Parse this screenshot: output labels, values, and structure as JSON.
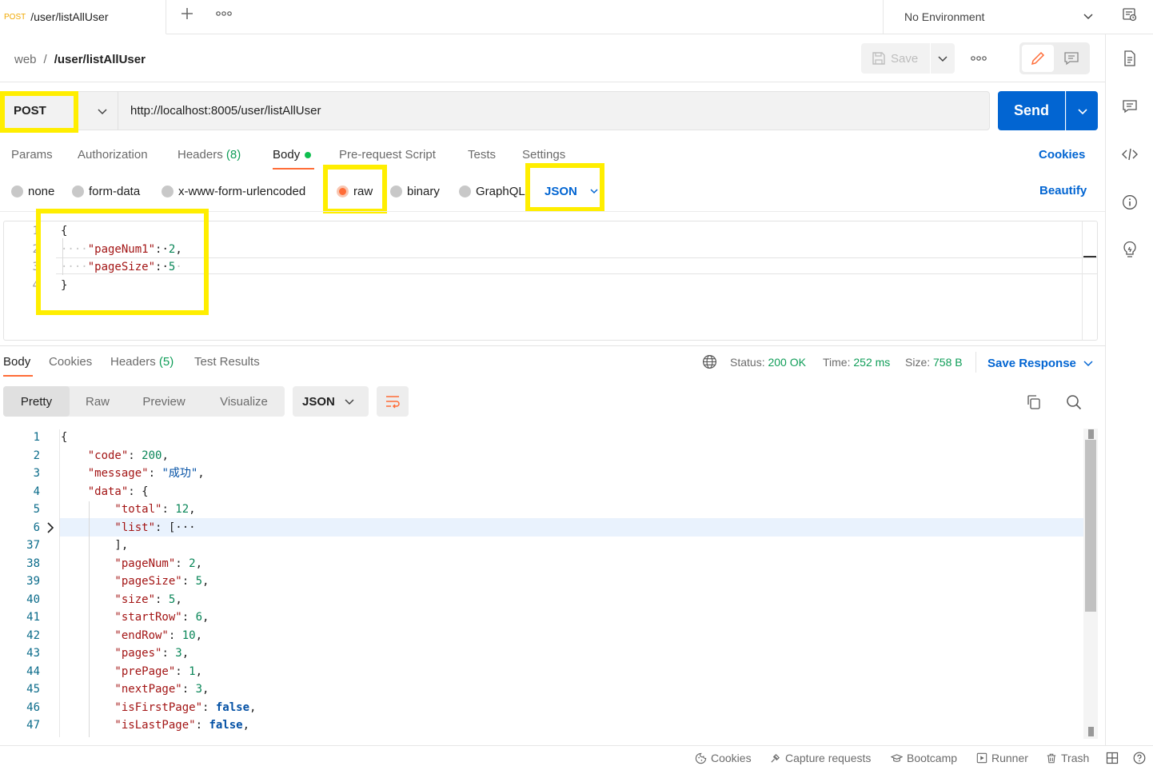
{
  "tab": {
    "method": "POST",
    "title": "/user/listAllUser"
  },
  "env": {
    "label": "No Environment"
  },
  "breadcrumb": {
    "collection": "web",
    "separator": "/",
    "request": "/user/listAllUser"
  },
  "toolbar": {
    "save_label": "Save"
  },
  "request": {
    "method": "POST",
    "url": "http://localhost:8005/user/listAllUser",
    "send_label": "Send"
  },
  "req_tabs": {
    "params": "Params",
    "authorization": "Authorization",
    "headers": "Headers",
    "headers_count": "(8)",
    "body": "Body",
    "prerequest": "Pre-request Script",
    "tests": "Tests",
    "settings": "Settings",
    "cookies": "Cookies"
  },
  "body_types": {
    "none": "none",
    "form_data": "form-data",
    "urlencoded": "x-www-form-urlencoded",
    "raw": "raw",
    "binary": "binary",
    "graphql": "GraphQL",
    "format": "JSON",
    "beautify": "Beautify"
  },
  "editor": {
    "line_numbers": [
      "1",
      "2",
      "3",
      "4"
    ],
    "lines": [
      [
        {
          "t": "{",
          "c": "p"
        }
      ],
      [
        {
          "t": "····",
          "c": "ws"
        },
        {
          "t": "\"pageNum1\"",
          "c": "k"
        },
        {
          "t": ":·",
          "c": "p"
        },
        {
          "t": "2",
          "c": "n"
        },
        {
          "t": ",",
          "c": "p"
        }
      ],
      [
        {
          "t": "····",
          "c": "ws"
        },
        {
          "t": "\"pageSize\"",
          "c": "k"
        },
        {
          "t": ":·",
          "c": "p"
        },
        {
          "t": "5",
          "c": "n"
        },
        {
          "t": "·",
          "c": "ws"
        }
      ],
      [
        {
          "t": "}",
          "c": "p"
        }
      ]
    ]
  },
  "resp_tabs": {
    "body": "Body",
    "cookies": "Cookies",
    "headers": "Headers",
    "headers_count": "(5)",
    "test_results": "Test Results"
  },
  "status": {
    "status_label": "Status:",
    "status_value": "200 OK",
    "time_label": "Time:",
    "time_value": "252 ms",
    "size_label": "Size:",
    "size_value": "758 B",
    "save_response": "Save Response"
  },
  "view_modes": {
    "pretty": "Pretty",
    "raw": "Raw",
    "preview": "Preview",
    "visualize": "Visualize",
    "format": "JSON"
  },
  "response": {
    "line_numbers": [
      "1",
      "2",
      "3",
      "4",
      "5",
      "6",
      "37",
      "38",
      "39",
      "40",
      "41",
      "42",
      "43",
      "44",
      "45",
      "46",
      "47"
    ],
    "lines": [
      [
        {
          "t": "{",
          "c": "p"
        }
      ],
      [
        {
          "t": "    \"code\"",
          "c": "k"
        },
        {
          "t": ": ",
          "c": "p"
        },
        {
          "t": "200",
          "c": "n"
        },
        {
          "t": ",",
          "c": "p"
        }
      ],
      [
        {
          "t": "    \"message\"",
          "c": "k"
        },
        {
          "t": ": ",
          "c": "p"
        },
        {
          "t": "\"成功\"",
          "c": "s"
        },
        {
          "t": ",",
          "c": "p"
        }
      ],
      [
        {
          "t": "    \"data\"",
          "c": "k"
        },
        {
          "t": ": {",
          "c": "p"
        }
      ],
      [
        {
          "t": "        \"total\"",
          "c": "k"
        },
        {
          "t": ": ",
          "c": "p"
        },
        {
          "t": "12",
          "c": "n"
        },
        {
          "t": ",",
          "c": "p"
        }
      ],
      [
        {
          "t": "        \"list\"",
          "c": "k"
        },
        {
          "t": ": [···",
          "c": "p"
        }
      ],
      [
        {
          "t": "        ],",
          "c": "p"
        }
      ],
      [
        {
          "t": "        \"pageNum\"",
          "c": "k"
        },
        {
          "t": ": ",
          "c": "p"
        },
        {
          "t": "2",
          "c": "n"
        },
        {
          "t": ",",
          "c": "p"
        }
      ],
      [
        {
          "t": "        \"pageSize\"",
          "c": "k"
        },
        {
          "t": ": ",
          "c": "p"
        },
        {
          "t": "5",
          "c": "n"
        },
        {
          "t": ",",
          "c": "p"
        }
      ],
      [
        {
          "t": "        \"size\"",
          "c": "k"
        },
        {
          "t": ": ",
          "c": "p"
        },
        {
          "t": "5",
          "c": "n"
        },
        {
          "t": ",",
          "c": "p"
        }
      ],
      [
        {
          "t": "        \"startRow\"",
          "c": "k"
        },
        {
          "t": ": ",
          "c": "p"
        },
        {
          "t": "6",
          "c": "n"
        },
        {
          "t": ",",
          "c": "p"
        }
      ],
      [
        {
          "t": "        \"endRow\"",
          "c": "k"
        },
        {
          "t": ": ",
          "c": "p"
        },
        {
          "t": "10",
          "c": "n"
        },
        {
          "t": ",",
          "c": "p"
        }
      ],
      [
        {
          "t": "        \"pages\"",
          "c": "k"
        },
        {
          "t": ": ",
          "c": "p"
        },
        {
          "t": "3",
          "c": "n"
        },
        {
          "t": ",",
          "c": "p"
        }
      ],
      [
        {
          "t": "        \"prePage\"",
          "c": "k"
        },
        {
          "t": ": ",
          "c": "p"
        },
        {
          "t": "1",
          "c": "n"
        },
        {
          "t": ",",
          "c": "p"
        }
      ],
      [
        {
          "t": "        \"nextPage\"",
          "c": "k"
        },
        {
          "t": ": ",
          "c": "p"
        },
        {
          "t": "3",
          "c": "n"
        },
        {
          "t": ",",
          "c": "p"
        }
      ],
      [
        {
          "t": "        \"isFirstPage\"",
          "c": "k"
        },
        {
          "t": ": ",
          "c": "p"
        },
        {
          "t": "false",
          "c": "b"
        },
        {
          "t": ",",
          "c": "p"
        }
      ],
      [
        {
          "t": "        \"isLastPage\"",
          "c": "k"
        },
        {
          "t": ": ",
          "c": "p"
        },
        {
          "t": "false",
          "c": "b"
        },
        {
          "t": ",",
          "c": "p"
        }
      ]
    ]
  },
  "footer": {
    "cookies": "Cookies",
    "capture": "Capture requests",
    "bootcamp": "Bootcamp",
    "runner": "Runner",
    "trash": "Trash"
  },
  "icons": [
    "plus-icon",
    "more-icon",
    "chevron-down-icon",
    "environment-quick-look-icon",
    "save-icon",
    "edit-icon",
    "comment-icon",
    "documentation-icon",
    "code-icon",
    "info-icon",
    "lightbulb-icon",
    "globe-icon",
    "copy-icon",
    "search-icon",
    "wrap-lines-icon",
    "chevron-right-icon",
    "cookie-icon",
    "capture-icon",
    "bootcamp-icon",
    "runner-icon",
    "trash-icon",
    "layout-icon",
    "help-icon"
  ],
  "colors": {
    "accent": "#ff6c37",
    "primary": "#0265d2",
    "success": "#0f9d58",
    "highlight": "#ffee00",
    "method_post": "#f0a800"
  }
}
